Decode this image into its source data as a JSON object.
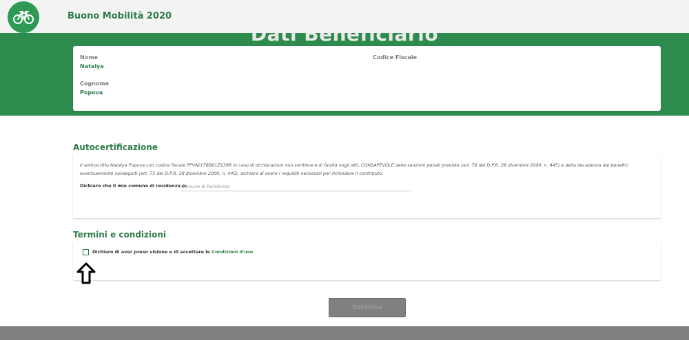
{
  "header": {
    "logo_icon": "bicycle-icon",
    "title": "Buono Mobilità 2020"
  },
  "beneficiary": {
    "heading": "Dati Beneficiario",
    "fields": {
      "nome_label": "Nome",
      "nome_value": "Natalya",
      "cognome_label": "Cognome",
      "cognome_value": "Popova",
      "codice_fiscale_label": "Codice Fiscale",
      "codice_fiscale_value": ""
    }
  },
  "autocertificazione": {
    "title": "Autocertificazione",
    "text": "Il sottoscritto Natalya Popova con codice fiscale PPVNLY78B61Z138R in caso di dichiarazioni non veritiere e di falsità negli atti, CONSAPEVOLE delle sanzioni penali previste (art. 76 del D.P.R. 28 dicembre 2000, n. 445) e della decadenza dai benefici eventualmente conseguiti (art. 75 del D.P.R. 28 dicembre 2000, n. 445), dichiara di avere i requisiti necessari per richiedere il contributo.",
    "residence_label": "Dichiaro che il mio comune di residenza è:",
    "residence_placeholder": "Comune di Residenza",
    "residence_value": ""
  },
  "terms": {
    "title": "Termini e condizioni",
    "checkbox_label": "Dichiaro di aver preso visione e di accettare le ",
    "link_label": "Condizioni d'uso",
    "checked": false
  },
  "actions": {
    "continue_label": "Continua"
  },
  "annotation": {
    "icon": "up-arrow-icon"
  },
  "colors": {
    "brand_green": "#2e8b4e",
    "text_green": "#2e7d4a",
    "disabled_button": "#808080"
  }
}
